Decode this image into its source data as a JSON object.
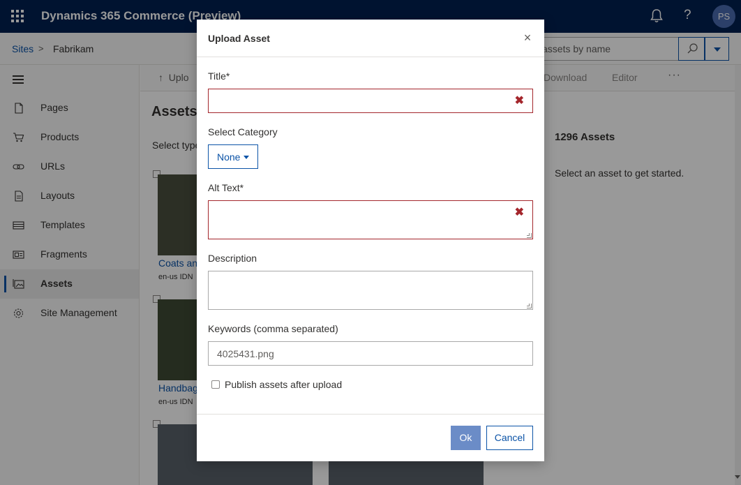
{
  "app": {
    "title": "Dynamics 365 Commerce (Preview)",
    "user_initials": "PS",
    "help_glyph": "?"
  },
  "breadcrumb": {
    "sites": "Sites",
    "separator": ">",
    "current": "Fabrikam"
  },
  "search": {
    "placeholder": "Search assets by name",
    "visible_value": "assets by name"
  },
  "sidebar": {
    "items": [
      {
        "label": "Pages",
        "icon": "page-icon"
      },
      {
        "label": "Products",
        "icon": "cart-icon"
      },
      {
        "label": "URLs",
        "icon": "link-icon"
      },
      {
        "label": "Layouts",
        "icon": "layout-icon"
      },
      {
        "label": "Templates",
        "icon": "template-icon"
      },
      {
        "label": "Fragments",
        "icon": "fragment-icon"
      },
      {
        "label": "Assets",
        "icon": "assets-icon",
        "active": true
      },
      {
        "label": "Site Management",
        "icon": "gear-icon"
      }
    ]
  },
  "toolbar": {
    "upload": "Uplo",
    "download": "Download",
    "editor": "Editor",
    "more": "···"
  },
  "main": {
    "title": "Assets",
    "select_type": "Select type",
    "asset_count": "1296 Assets",
    "asset_hint": "Select an asset to get started.",
    "thumbs": [
      {
        "label": "Coats and",
        "meta": "en-us  IDN"
      },
      {
        "label": "Handbag",
        "meta": "en-us  IDN"
      }
    ]
  },
  "modal": {
    "title": "Upload Asset",
    "close": "×",
    "title_label": "Title*",
    "title_value": "",
    "category_label": "Select Category",
    "category_value": "None",
    "alt_label": "Alt Text*",
    "alt_value": "",
    "description_label": "Description",
    "description_value": "",
    "keywords_label": "Keywords (comma separated)",
    "keywords_value": "4025431.png",
    "publish_label": "Publish assets after upload",
    "publish_checked": false,
    "ok": "Ok",
    "cancel": "Cancel",
    "error_glyph": "✖"
  },
  "colors": {
    "topbar": "#002050",
    "accent": "#0b53a7",
    "error": "#a4262c",
    "ok_disabled": "#6b8cc7"
  }
}
